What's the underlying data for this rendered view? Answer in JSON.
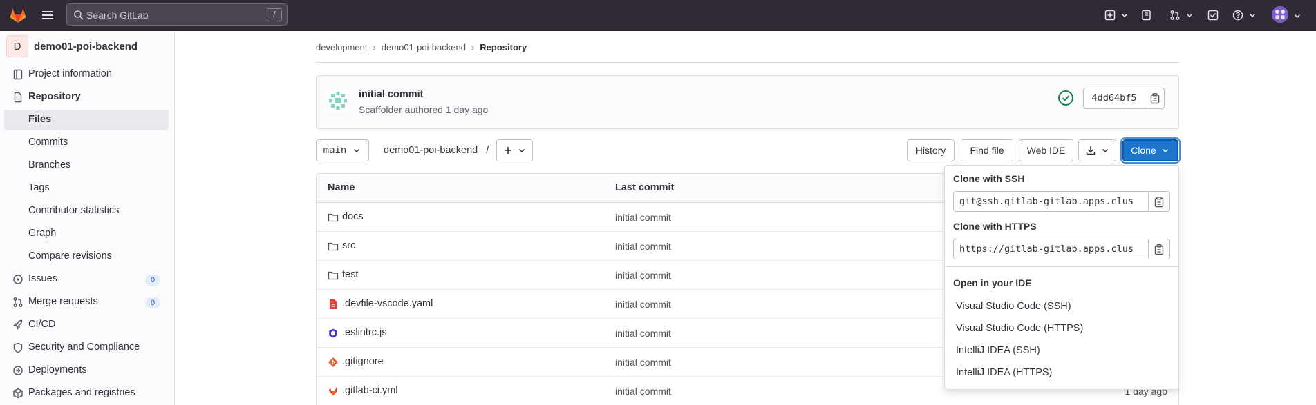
{
  "colors": {
    "topbar": "#2f2a36",
    "primary": "#1f75cb",
    "success": "#108548"
  },
  "search": {
    "placeholder": "Search GitLab",
    "shortcut": "/"
  },
  "project": {
    "avatar_letter": "D",
    "name": "demo01-poi-backend"
  },
  "sidebar": {
    "items": [
      {
        "label": "Project information",
        "icon": "project-info-icon"
      },
      {
        "label": "Repository",
        "icon": "repository-icon"
      },
      {
        "label": "Files"
      },
      {
        "label": "Commits"
      },
      {
        "label": "Branches"
      },
      {
        "label": "Tags"
      },
      {
        "label": "Contributor statistics"
      },
      {
        "label": "Graph"
      },
      {
        "label": "Compare revisions"
      },
      {
        "label": "Issues",
        "icon": "issues-icon",
        "badge": "0"
      },
      {
        "label": "Merge requests",
        "icon": "merge-request-icon",
        "badge": "0"
      },
      {
        "label": "CI/CD",
        "icon": "rocket-icon"
      },
      {
        "label": "Security and Compliance",
        "icon": "shield-icon"
      },
      {
        "label": "Deployments",
        "icon": "deployments-icon"
      },
      {
        "label": "Packages and registries",
        "icon": "package-icon"
      }
    ]
  },
  "breadcrumb": [
    "development",
    "demo01-poi-backend",
    "Repository"
  ],
  "commit": {
    "title": "initial commit",
    "meta": "Scaffolder authored 1 day ago",
    "sha": "4dd64bf5"
  },
  "toolbar": {
    "branch": "main",
    "path": "demo01-poi-backend",
    "path_sep": "/",
    "history": "History",
    "find_file": "Find file",
    "web_ide": "Web IDE",
    "clone": "Clone"
  },
  "table": {
    "headers": {
      "name": "Name",
      "last_commit": "Last commit"
    },
    "rows": [
      {
        "name": "docs",
        "icon": "folder-icon",
        "commit": "initial commit",
        "date": ""
      },
      {
        "name": "src",
        "icon": "folder-icon",
        "commit": "initial commit",
        "date": ""
      },
      {
        "name": "test",
        "icon": "folder-icon",
        "commit": "initial commit",
        "date": ""
      },
      {
        "name": ".devfile-vscode.yaml",
        "icon": "yaml-file-icon",
        "commit": "initial commit",
        "date": ""
      },
      {
        "name": ".eslintrc.js",
        "icon": "eslint-file-icon",
        "commit": "initial commit",
        "date": ""
      },
      {
        "name": ".gitignore",
        "icon": "git-file-icon",
        "commit": "initial commit",
        "date": ""
      },
      {
        "name": ".gitlab-ci.yml",
        "icon": "gitlab-file-icon",
        "commit": "initial commit",
        "date": "1 day ago"
      }
    ]
  },
  "clone_dropdown": {
    "ssh_header": "Clone with SSH",
    "ssh_url": "git@ssh.gitlab-gitlab.apps.clus",
    "https_header": "Clone with HTTPS",
    "https_url": "https://gitlab-gitlab.apps.clus",
    "ide_header": "Open in your IDE",
    "ide_options": [
      "Visual Studio Code (SSH)",
      "Visual Studio Code (HTTPS)",
      "IntelliJ IDEA (SSH)",
      "IntelliJ IDEA (HTTPS)"
    ]
  }
}
